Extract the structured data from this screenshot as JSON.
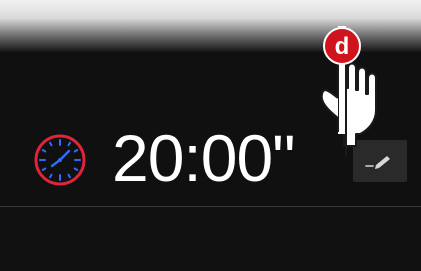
{
  "timer": {
    "value": "20:00\""
  },
  "annotation": {
    "badge_letter": "d",
    "badge_color": "#d0141d"
  },
  "icons": {
    "clock": "clock-icon",
    "edit": "pencil-icon",
    "hand": "pointing-hand-icon"
  },
  "colors": {
    "background": "#101010",
    "clock_ring": "#e0243a",
    "clock_ticks": "#2f6bff",
    "text": "#ffffff",
    "edit_button_bg": "#2a2a2a"
  }
}
